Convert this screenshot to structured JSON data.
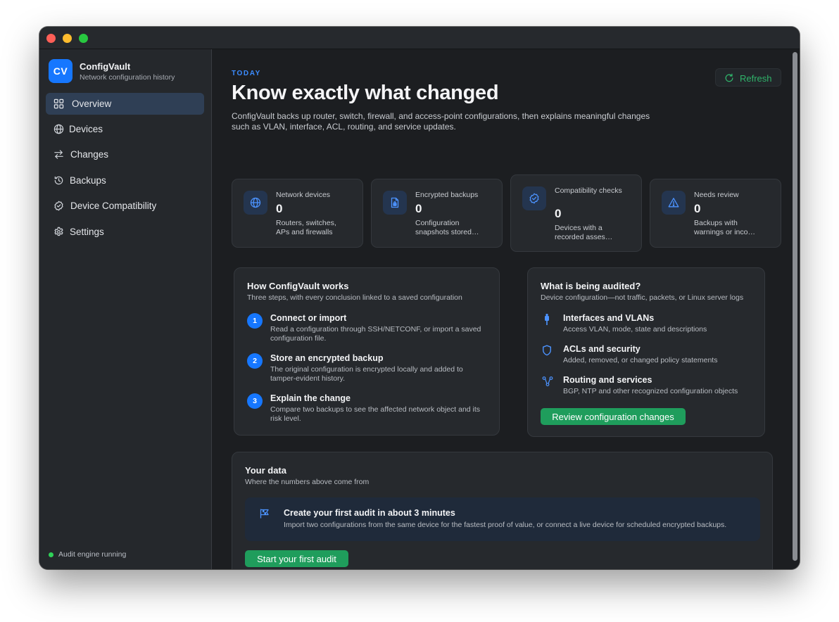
{
  "app": {
    "name": "ConfigVault",
    "tagline": "Network configuration history",
    "logo_text": "CV"
  },
  "sidebar": {
    "items": [
      {
        "label": "Overview",
        "icon": "grid-icon",
        "active": true
      },
      {
        "label": "Devices",
        "icon": "globe-icon"
      },
      {
        "label": "Changes",
        "icon": "arrows-icon"
      },
      {
        "label": "Backups",
        "icon": "history-icon"
      },
      {
        "label": "Device Compatibility",
        "icon": "badge-check-icon"
      },
      {
        "label": "Settings",
        "icon": "gear-icon"
      }
    ],
    "status": "Audit engine running"
  },
  "header": {
    "eyebrow": "TODAY",
    "title": "Know exactly what changed",
    "description": "ConfigVault backs up router, switch, firewall, and access-point configurations, then explains meaningful changes such as VLAN, interface, ACL, routing, and service updates.",
    "refresh_label": "Refresh"
  },
  "stats": [
    {
      "label": "Network devices",
      "value": "0",
      "sub": "Routers, switches, APs and firewalls",
      "icon": "globe-icon"
    },
    {
      "label": "Encrypted backups",
      "value": "0",
      "sub": "Configuration snapshots stored…",
      "icon": "lock-file-icon"
    },
    {
      "label": "Compatibility checks",
      "value": "0",
      "sub": "Devices with a recorded asses…",
      "icon": "badge-check-icon"
    },
    {
      "label": "Needs review",
      "value": "0",
      "sub": "Backups with warnings or inco…",
      "icon": "warning-icon"
    }
  ],
  "how_it_works": {
    "title": "How ConfigVault works",
    "subtitle": "Three steps, with every conclusion linked to a saved configuration",
    "steps": [
      {
        "num": "1",
        "title": "Connect or import",
        "desc": "Read a configuration through SSH/NETCONF, or import a saved configuration file."
      },
      {
        "num": "2",
        "title": "Store an encrypted backup",
        "desc": "The original configuration is encrypted locally and added to tamper-evident history."
      },
      {
        "num": "3",
        "title": "Explain the change",
        "desc": "Compare two backups to see the affected network object and its risk level."
      }
    ]
  },
  "audited": {
    "title": "What is being audited?",
    "subtitle": "Device configuration—not traffic, packets, or Linux server logs",
    "items": [
      {
        "title": "Interfaces and VLANs",
        "desc": "Access VLAN, mode, state and descriptions",
        "icon": "plug-icon"
      },
      {
        "title": "ACLs and security",
        "desc": "Added, removed, or changed policy statements",
        "icon": "shield-icon"
      },
      {
        "title": "Routing and services",
        "desc": "BGP, NTP and other recognized configuration objects",
        "icon": "network-icon"
      }
    ],
    "button_label": "Review configuration changes"
  },
  "your_data": {
    "title": "Your data",
    "subtitle": "Where the numbers above come from",
    "callout_title": "Create your first audit in about 3 minutes",
    "callout_desc": "Import two configurations from the same device for the fastest proof of value, or connect a live device for scheduled encrypted backups.",
    "button_label": "Start your first audit"
  },
  "colors": {
    "accent": "#1677ff",
    "success": "#1f9d5c",
    "status_dot": "#2fd158",
    "window_bg": "#1c1e21",
    "sidebar_bg": "#25282c"
  }
}
